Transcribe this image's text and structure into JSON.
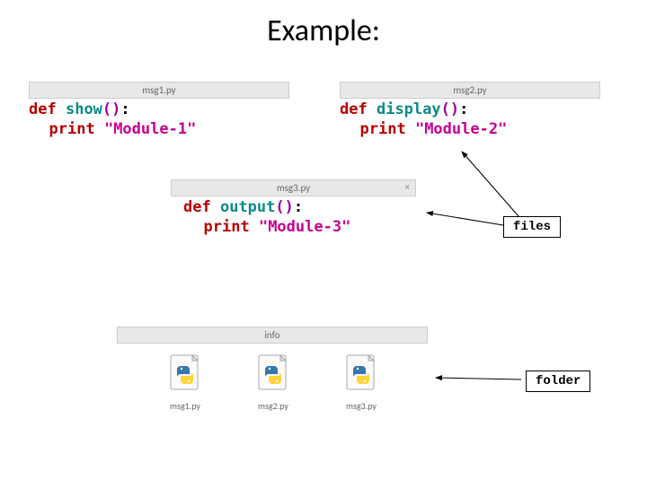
{
  "title": "Example:",
  "tabs": {
    "t1": "msg1.py",
    "t2": "msg2.py",
    "t3": "msg3.py",
    "close": "×"
  },
  "code": {
    "kw_def": "def",
    "kw_print": "print",
    "msg1": {
      "fn": "show",
      "str": "\"Module-1\""
    },
    "msg2": {
      "fn": "display",
      "str": "\"Module-2\""
    },
    "msg3": {
      "fn": "output",
      "str": "\"Module-3\""
    },
    "parens": "()",
    "colon": ":"
  },
  "labels": {
    "files": "files",
    "folder": "folder"
  },
  "folder": {
    "name": "info",
    "items": [
      "msg1.py",
      "msg2.py",
      "msg3.py"
    ]
  }
}
